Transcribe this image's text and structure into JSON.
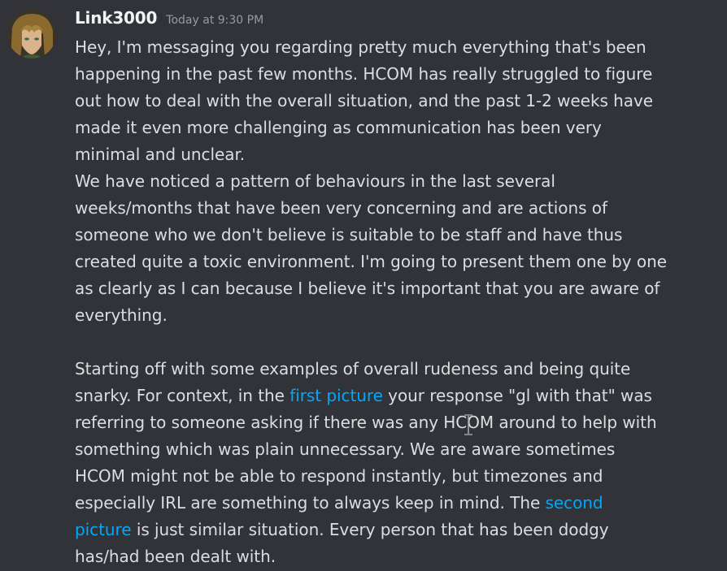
{
  "message": {
    "username": "Link3000",
    "timestamp": "Today at 9:30 PM",
    "avatar_icon": "user-avatar-icon",
    "colors": {
      "background": "#313338",
      "text": "#dbdee1",
      "username": "#f2f3f5",
      "timestamp": "#949ba4",
      "link": "#00a8fc"
    },
    "lines": [
      "Hey, I'm messaging you regarding pretty much everything that's been",
      "happening in the past few months. HCOM has really struggled to figure",
      "out how to deal with the overall situation, and the past 1-2 weeks have",
      "made it even more challenging as communication has been very",
      "minimal and unclear.",
      "We have noticed a pattern of behaviours in the last several",
      "weeks/months that have been very concerning and are actions of",
      "someone who we don't believe is suitable to be staff and have thus",
      "created quite a toxic environment. I'm going to present them one by one",
      "as clearly as I can because I believe it's important that you are aware of",
      "everything."
    ],
    "p2": {
      "l1": "Starting off with some examples of overall rudeness and being quite",
      "l2_pre": "snarky. For context, in the ",
      "link1": "first picture",
      "l2_post": " your response \"gl with that\" was",
      "l3": "referring to someone asking if there was any HCOM around to help with",
      "l4": "something which was plain unnecessary. We are aware sometimes",
      "l5": "HCOM might not be able to respond instantly, but timezones and",
      "l6_pre": "especially IRL are something to always keep in mind. The ",
      "link2a": "second",
      "link2b": "picture",
      "l7_post": " is just similar situation. Every person that has been dodgy",
      "l8": "has/had been dealt with."
    }
  }
}
